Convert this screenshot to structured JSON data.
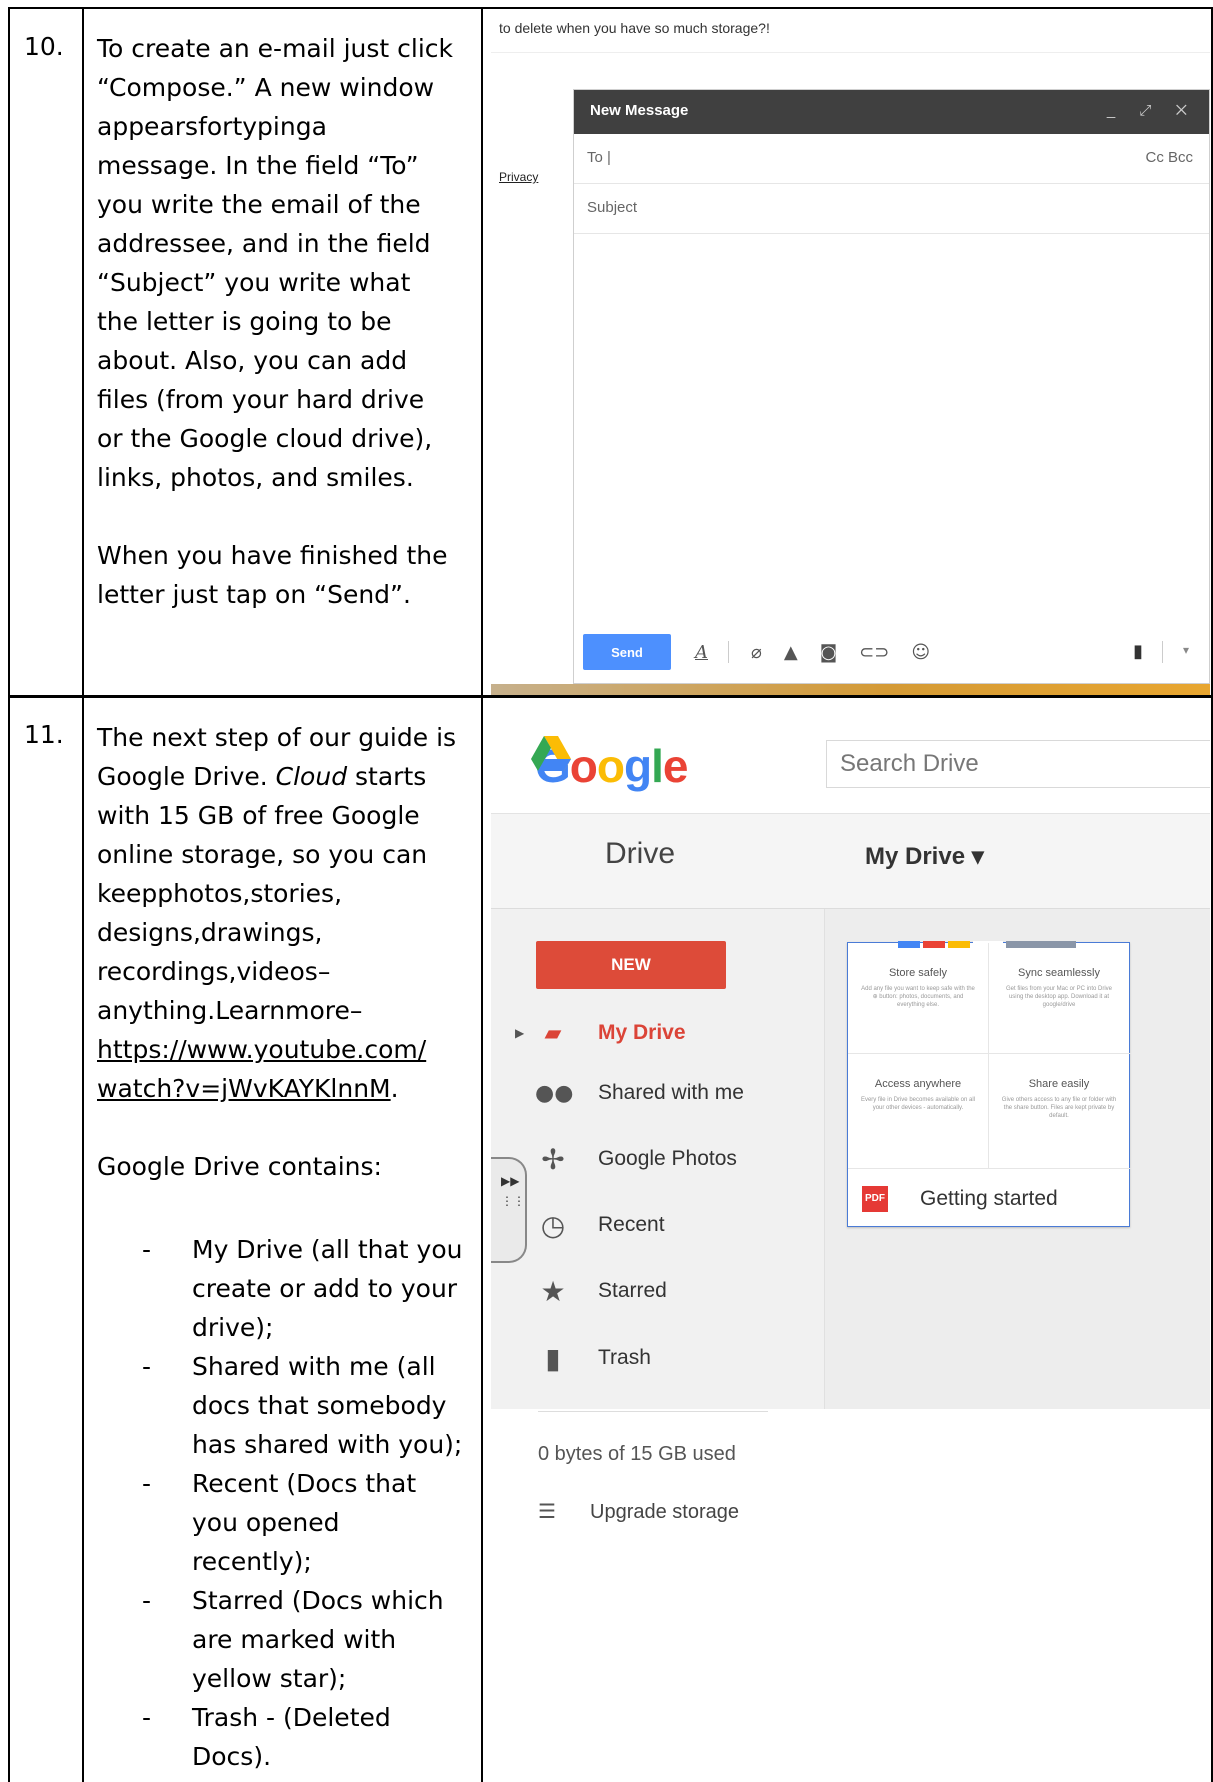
{
  "row10": {
    "number": "10.",
    "para1_lines": [
      "To create an e-mail just click",
      "“Compose.” A new window",
      [
        "appears",
        "for",
        "typing",
        "a"
      ],
      "message. In the field “To”",
      "you write the email of the",
      "addressee, and in the field",
      "“Subject” you write what",
      "the letter is going to be",
      "about. Also, you can add",
      "files (from your hard drive",
      "or the Google cloud drive),",
      "links, photos, and smiles."
    ],
    "para2_lines": [
      "When you have finished the",
      "letter just tap on “Send”."
    ]
  },
  "row11": {
    "number": "11.",
    "lines": {
      "l1": "The next step of our guide is",
      "l2a": "Google Drive. ",
      "l2b": "Cloud",
      "l2c": " starts",
      "l3": "with 15 GB of free Google",
      "l4": "online storage, so you can",
      "l5": [
        "keep",
        "photos,",
        "stories,"
      ],
      "l6": [
        "designs,",
        "drawings,"
      ],
      "l7": [
        "recordings,",
        "videos",
        "–"
      ],
      "l8": [
        "anything.",
        "Learn",
        "more",
        "–"
      ],
      "link1": "https://www.youtube.com/",
      "link2": "watch?v=jWvKAYKlnnM",
      "link2_after": ".",
      "contains": "Google Drive contains:"
    },
    "bullets": [
      {
        "dash": "-",
        "text": "My Drive (all that you create or add to your drive);"
      },
      {
        "dash": "-",
        "text": "Shared with me (all docs that somebody has shared with you);"
      },
      {
        "dash": "-",
        "text": "Recent (Docs that you opened recently);"
      },
      {
        "dash": "-",
        "text": "Starred (Docs which are marked with yellow star);"
      },
      {
        "dash": "-",
        "text": "Trash - (Deleted Docs)."
      }
    ]
  },
  "gmail": {
    "top_text": "to delete when you have so much storage?!",
    "privacy": "Privacy",
    "title": "New Message",
    "window_controls": "_ ⤢ ✕",
    "to_label": "To |",
    "cc_bcc": "Cc  Bcc",
    "subject_placeholder": "Subject",
    "send_label": "Send",
    "icons": [
      "format-icon",
      "attach-icon",
      "drive-icon",
      "photo-icon",
      "link-icon",
      "emoji-icon",
      "trash-icon",
      "more-icon"
    ],
    "send_color": "#4d90fe",
    "header_color": "#404040"
  },
  "drive": {
    "logo_letters": [
      {
        "ch": "G",
        "color": "#4285f4"
      },
      {
        "ch": "o",
        "color": "#ea4335"
      },
      {
        "ch": "o",
        "color": "#fbbc05"
      },
      {
        "ch": "g",
        "color": "#4285f4"
      },
      {
        "ch": "l",
        "color": "#34a853"
      },
      {
        "ch": "e",
        "color": "#ea4335"
      }
    ],
    "search_placeholder": "Search Drive",
    "drive_word": "Drive",
    "my_drive_title": "My Drive ▾",
    "new_label": "NEW",
    "nav": [
      {
        "label": "My Drive",
        "icon": "folder-icon"
      },
      {
        "label": "Shared with me",
        "icon": "people-icon"
      },
      {
        "label": "Google Photos",
        "icon": "pinwheel-icon"
      },
      {
        "label": "Recent",
        "icon": "clock-icon"
      },
      {
        "label": "Starred",
        "icon": "star-icon"
      },
      {
        "label": "Trash",
        "icon": "trash-icon"
      }
    ],
    "storage_text": "0 bytes of 15 GB used",
    "upgrade_text": "Upgrade storage",
    "card": {
      "quads": [
        {
          "title": "Store safely",
          "desc": "Add any file you want to keep safe with the ⊕ button: photos, documents, and everything else."
        },
        {
          "title": "Sync seamlessly",
          "desc": "Get files from your Mac or PC into Drive using the desktop app. Download it at google/drive"
        },
        {
          "title": "Access anywhere",
          "desc": "Every file in Drive becomes available on all your other devices - automatically."
        },
        {
          "title": "Share easily",
          "desc": "Give others access to any file or folder with the share button. Files are kept private by default."
        }
      ],
      "pdf_label": "PDF",
      "file_name": "Getting started"
    },
    "new_color": "#dd4b39"
  }
}
